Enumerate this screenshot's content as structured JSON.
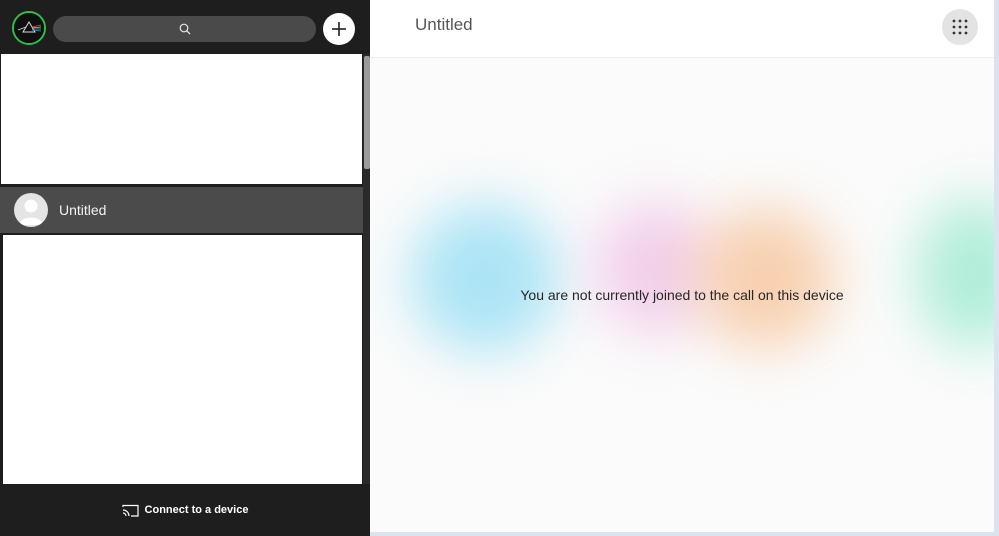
{
  "sidebar": {
    "search": {
      "icon": "search-icon"
    },
    "add_button": {
      "icon": "plus-icon"
    },
    "chat_list": [
      {
        "label": "Untitled",
        "avatar_icon": "default-avatar-icon",
        "selected": true
      }
    ],
    "connect_label": "Connect to a device",
    "connect_icon": "cast-icon",
    "collapse_icon": "chevron-left-icon"
  },
  "main": {
    "title": "Untitled",
    "menu_icon": "grid-dots-icon",
    "status_message": "You are not currently joined to the call on this device"
  },
  "colors": {
    "sidebar_bg": "#1e1e1e",
    "selected_row": "#4b4b4b",
    "avatar_ring": "#2fbf4a",
    "accent_blob_blue": "#a8e3f5",
    "accent_blob_pink": "#f0c6e8",
    "accent_blob_orange": "#f7c9a3",
    "accent_blob_green": "#a9ecd6"
  }
}
